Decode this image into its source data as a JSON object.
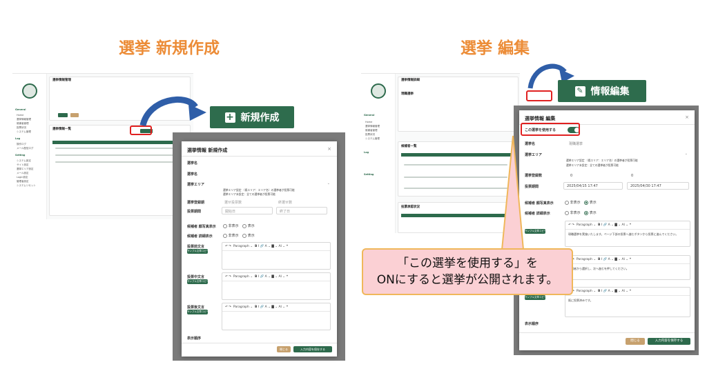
{
  "titles": {
    "create": "選挙 新規作成",
    "edit": "選挙 編集"
  },
  "callouts": {
    "create_button": "新規作成",
    "edit_button": "情報編集",
    "create_icon": "plus-square-icon",
    "edit_icon": "edit-icon"
  },
  "bubble": {
    "line1": "「この選挙を使用する」を",
    "line2": "ONにすると選挙が公開されます。"
  },
  "left_bg": {
    "page_title": "選挙情報管理",
    "list_title": "選挙情報一覧",
    "reset": "検索する",
    "clear": "リセット",
    "sections": [
      "General",
      "Log",
      "Setting"
    ],
    "sidebar_items": [
      "Home",
      "選挙情報管理",
      "候補者管理",
      "投票状況",
      "システム管理",
      "操作ログ",
      "メール配信ログ",
      "システム設定",
      "サイト設定",
      "選挙エリア設定",
      "メール設定",
      "Login設定",
      "管理者設定",
      "システムリセット"
    ]
  },
  "right_bg": {
    "page_title": "選挙情報詳細",
    "section1": "現職選挙",
    "section2": "候補者一覧",
    "section3": "投票承認状況"
  },
  "create_modal": {
    "title": "選挙情報 新規作成",
    "label_name": "選挙名",
    "label_code": "選挙名",
    "label_area": "選挙エリア",
    "area_text1": "選挙エリア設定 （県エリア：エリア名）の選挙者が投票可能",
    "area_text2": "選挙エリア未設定：全ての選挙者が投票可能",
    "label_start": "選挙登録期",
    "label_period": "投票期間",
    "ph_start": "選せ投票数",
    "ph_end": "終選せ数",
    "date_from": "開始日",
    "date_to": "終了日",
    "label_photo": "候補者 顔写真表示",
    "label_detail": "候補者 詳細表示",
    "radio_hide": "非表示",
    "radio_show": "表示",
    "label_pre": "投票前文言",
    "label_mid": "投票中文言",
    "label_post": "投票後文言",
    "sample_btn": "サンプル文章コピー",
    "editor_tb": "Paragraph",
    "label_order": "表示順序",
    "close": "閉じる",
    "save": "入力内容を保存する"
  },
  "edit_modal": {
    "title": "選挙情報 編集",
    "use_label": "この選挙を使用する",
    "label_name": "選挙名",
    "name_value": "現職選挙",
    "label_area": "選挙エリア",
    "area_text1": "選挙エリア設定 （県エリア：エリア名）の選挙者が投票可能",
    "area_text2": "選挙エリア未設定：全ての選挙者が投票可能",
    "label_start": "選挙登録数",
    "start_value": "0",
    "start_value2": "0",
    "label_period": "投票期間",
    "date_from": "2025/04/15 17:47",
    "date_to": "2025/04/30 17:47",
    "label_photo": "候補者 顔写真表示",
    "label_detail": "候補者 詳細表示",
    "radio_hide": "非表示",
    "radio_show": "表示",
    "editor_tb": "Paragraph",
    "editor1_text": "現職選挙を実施いたします。ページ下部の投票へ進むボタンから投票に進んでください。",
    "editor2_text": "候補者から選択し、次へ進むを押してください。",
    "editor3_text": "既に投票済みです。",
    "sample_btn": "サンプル文章コピー",
    "label_order": "表示順序",
    "close": "閉じる",
    "save": "入力内容を保存する"
  },
  "colors": {
    "accent": "#ec8c37",
    "brand": "#2d6a4c",
    "highlight": "#e02020",
    "arrow": "#2f5ea8"
  }
}
